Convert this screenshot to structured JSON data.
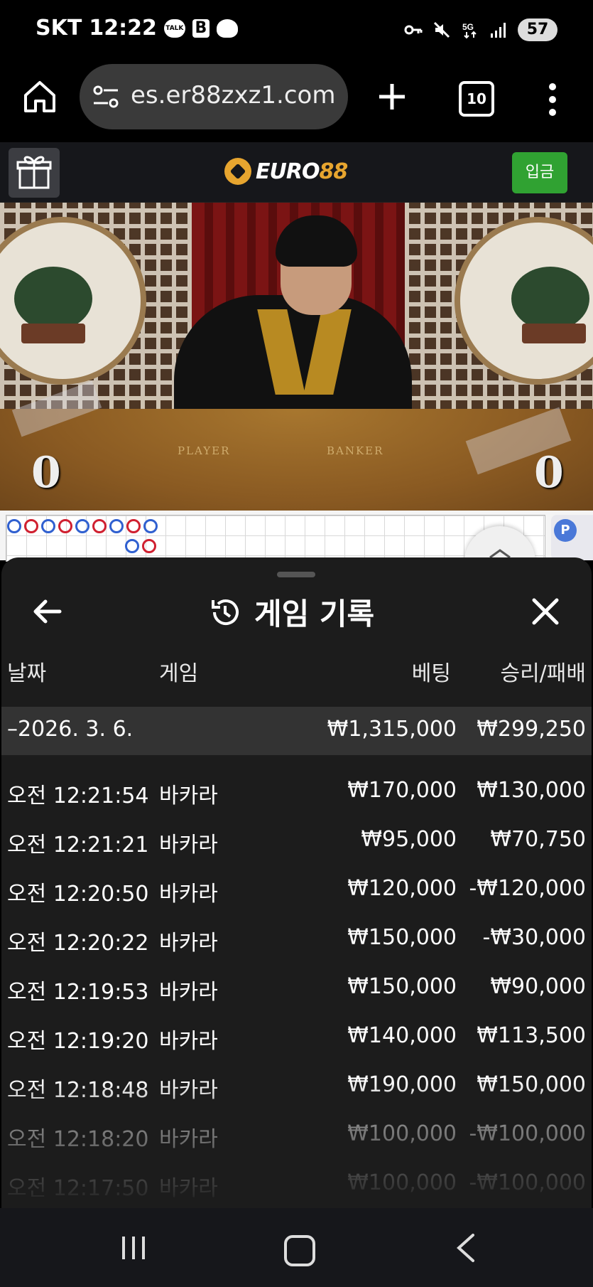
{
  "status_bar": {
    "carrier": "SKT",
    "time": "12:22",
    "notification_icons": [
      "kakaotalk-icon",
      "b-app-icon",
      "cloud-icon"
    ],
    "system_icons": [
      "key-icon",
      "mute-icon",
      "5g-icon",
      "signal-icon"
    ],
    "battery": "57",
    "talk_label": "TALK"
  },
  "browser": {
    "url": "es.er88zxz1.com",
    "tab_count": "10"
  },
  "site_header": {
    "logo_text_a": "EURO",
    "logo_text_b": "88",
    "deposit_label": "입금"
  },
  "video": {
    "player_label": "PLAYER",
    "banker_label": "BANKER",
    "player_score": "0",
    "banker_score": "0"
  },
  "roadmap": {
    "row1": [
      "blue",
      "red",
      "blue",
      "red",
      "blue",
      "red",
      "blue",
      "red",
      "blue"
    ],
    "row2": [
      "blue",
      "red"
    ],
    "side_label": "P"
  },
  "sheet": {
    "title": "게임 기록",
    "columns": {
      "date": "날짜",
      "game": "게임",
      "bet": "베팅",
      "win_loss": "승리/패배"
    },
    "summary": {
      "date": "–2026. 3. 6.",
      "bet": "₩1,315,000",
      "win_loss": "₩299,250"
    },
    "rows": [
      {
        "time": "오전 12:21:54",
        "game": "바카라",
        "bet": "₩170,000",
        "win_loss": "₩130,000"
      },
      {
        "time": "오전 12:21:21",
        "game": "바카라",
        "bet": "₩95,000",
        "win_loss": "₩70,750"
      },
      {
        "time": "오전 12:20:50",
        "game": "바카라",
        "bet": "₩120,000",
        "win_loss": "-₩120,000"
      },
      {
        "time": "오전 12:20:22",
        "game": "바카라",
        "bet": "₩150,000",
        "win_loss": "-₩30,000"
      },
      {
        "time": "오전 12:19:53",
        "game": "바카라",
        "bet": "₩150,000",
        "win_loss": "₩90,000"
      },
      {
        "time": "오전 12:19:20",
        "game": "바카라",
        "bet": "₩140,000",
        "win_loss": "₩113,500"
      },
      {
        "time": "오전 12:18:48",
        "game": "바카라",
        "bet": "₩190,000",
        "win_loss": "₩150,000"
      },
      {
        "time": "오전 12:18:20",
        "game": "바카라",
        "bet": "₩100,000",
        "win_loss": "-₩100,000"
      },
      {
        "time": "오전 12:17:50",
        "game": "바카라",
        "bet": "₩100,000",
        "win_loss": "-₩100,000"
      }
    ]
  },
  "colors": {
    "accent_green": "#30a232",
    "logo_gold": "#e7a52f",
    "sheet_bg": "#1c1c1c",
    "summary_bg": "#333333"
  }
}
